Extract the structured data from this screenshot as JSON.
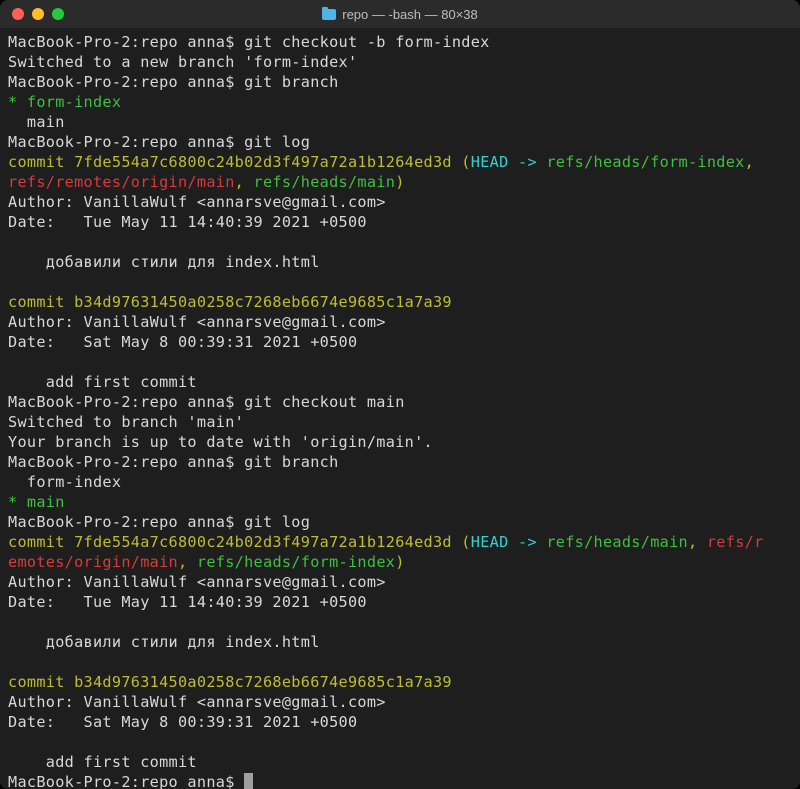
{
  "titlebar": {
    "title": "repo — -bash — 80×38"
  },
  "prompt": "MacBook-Pro-2:repo anna$ ",
  "commands": {
    "checkout_new": "git checkout -b form-index",
    "branch": "git branch",
    "log": "git log",
    "checkout_main": "git checkout main"
  },
  "output": {
    "switched_new": "Switched to a new branch 'form-index'",
    "switched_main": "Switched to branch 'main'",
    "uptodate": "Your branch is up to date with 'origin/main'.",
    "branch_list_1": {
      "current": "* form-index",
      "other": "  main"
    },
    "branch_list_2": {
      "other": "  form-index",
      "current": "* main"
    },
    "commit1": {
      "hash_line": "commit 7fde554a7c6800c24b02d3f497a72a1b1264ed3d",
      "refs_1_a": " (HEAD -> refs/heads/form-index,",
      "refs_1_b": "refs/remotes/origin/main",
      "refs_1_c": ", refs/heads/main)",
      "refs_2_a": " (HEAD -> refs/heads/main, refs/r",
      "refs_2_b": "emotes/origin/main",
      "refs_2_c": ", refs/heads/form-index)",
      "author": "Author: VanillaWulf <annarsve@gmail.com>",
      "date": "Date:   Tue May 11 14:40:39 2021 +0500",
      "msg": "    добавили стили для index.html"
    },
    "commit2": {
      "hash_line": "commit b34d97631450a0258c7268eb6674e9685c1a7a39",
      "author": "Author: VanillaWulf <annarsve@gmail.com>",
      "date": "Date:   Sat May 8 00:39:31 2021 +0500",
      "msg": "    add first commit"
    }
  },
  "colors": {
    "bg": "#1e1e1e",
    "fg": "#d8d8d8",
    "green": "#3fbf3f",
    "yellow": "#bdbd34",
    "cyan": "#2fd1d1",
    "red": "#d73b3b"
  }
}
